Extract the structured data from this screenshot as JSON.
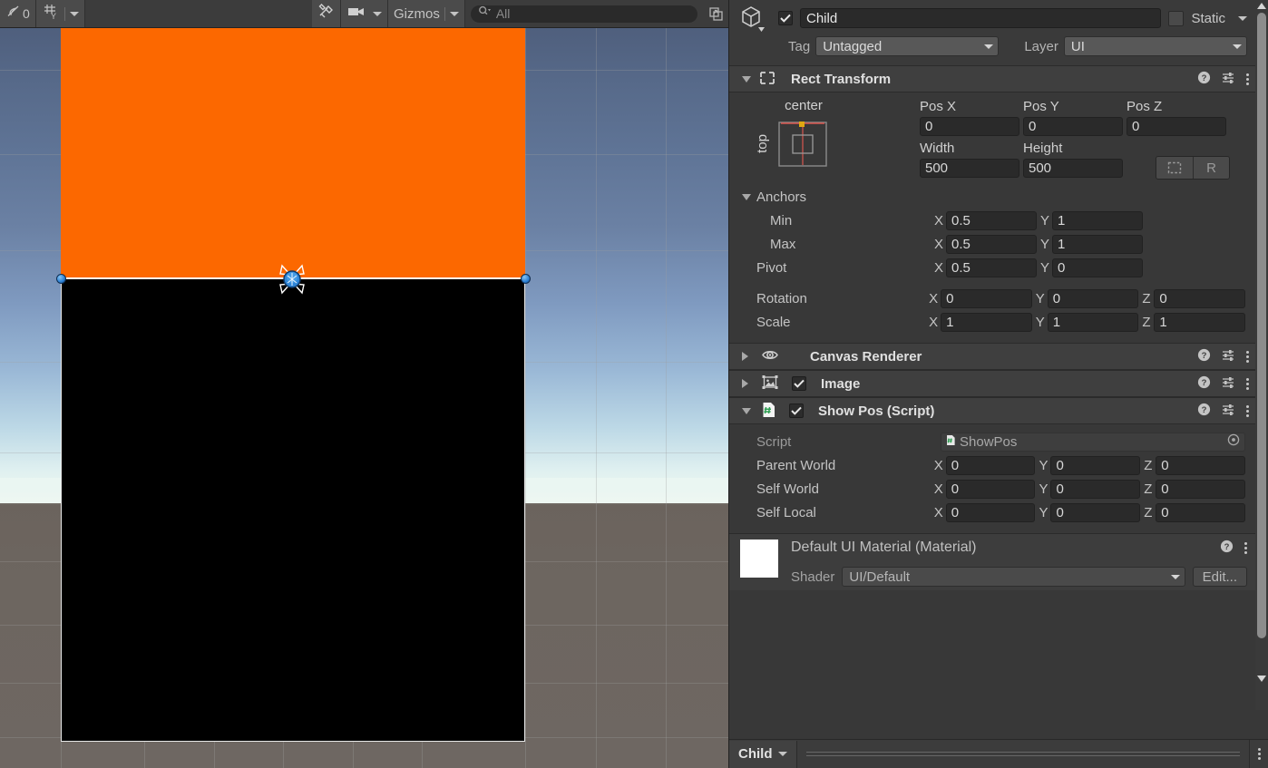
{
  "scene": {
    "toolbar": {
      "draw_mode_count": "0",
      "grid_axis": "Y",
      "gizmos_label": "Gizmos",
      "search_placeholder": "All",
      "search_value": "",
      "icons": {
        "lighting": "lighting-off-icon",
        "grid": "grid-axis-icon",
        "tools": "tools-icon",
        "camera": "scene-camera-icon",
        "search": "search-icon",
        "maximize": "open-in-new-icon"
      }
    },
    "selected_rect": {
      "fill_color": "#fc6800",
      "child_color": "#000000",
      "outline_color": "#ffffff"
    }
  },
  "inspector": {
    "object": {
      "enabled": true,
      "name_value": "Child",
      "name_placeholder": "Name",
      "static_label": "Static",
      "static_checked": false,
      "tag_label": "Tag",
      "tag_value": "Untagged",
      "layer_label": "Layer",
      "layer_value": "UI"
    },
    "rect_transform": {
      "title": "Rect Transform",
      "expanded": true,
      "anchor_preset": {
        "horizontal": "center",
        "vertical": "top"
      },
      "columns": [
        "Pos X",
        "Pos Y",
        "Pos Z"
      ],
      "pos": {
        "x": "0",
        "y": "0",
        "z": "0"
      },
      "size_columns": [
        "Width",
        "Height"
      ],
      "size": {
        "width": "500",
        "height": "500"
      },
      "blueprint_button": "blueprint-mode-icon",
      "raw_button": "R",
      "anchors_label": "Anchors",
      "anchors": {
        "min_label": "Min",
        "min_x": "0.5",
        "min_y": "1",
        "max_label": "Max",
        "max_x": "0.5",
        "max_y": "1"
      },
      "pivot": {
        "label": "Pivot",
        "x": "0.5",
        "y": "0"
      },
      "rotation": {
        "label": "Rotation",
        "x": "0",
        "y": "0",
        "z": "0"
      },
      "scale": {
        "label": "Scale",
        "x": "1",
        "y": "1",
        "z": "1"
      },
      "axis": {
        "x": "X",
        "y": "Y",
        "z": "Z"
      }
    },
    "components": [
      {
        "title": "Canvas Renderer",
        "expanded": false,
        "has_enable_toggle": false,
        "icon": "eye-icon"
      },
      {
        "title": "Image",
        "expanded": false,
        "has_enable_toggle": true,
        "enabled": true,
        "icon": "image-component-icon"
      },
      {
        "title": "Show Pos (Script)",
        "expanded": true,
        "has_enable_toggle": true,
        "enabled": true,
        "icon": "cs-script-icon"
      }
    ],
    "show_pos": {
      "script_label": "Script",
      "script_value": "ShowPos",
      "script_icon": "cs-script-icon",
      "object_picker": "object-picker-icon",
      "rows": [
        {
          "label": "Parent World",
          "x": "0",
          "y": "0",
          "z": "0"
        },
        {
          "label": "Self World",
          "x": "0",
          "y": "0",
          "z": "0"
        },
        {
          "label": "Self Local",
          "x": "0",
          "y": "0",
          "z": "0"
        }
      ]
    },
    "material": {
      "title": "Default UI Material (Material)",
      "shader_label": "Shader",
      "shader_value": "UI/Default",
      "edit_label": "Edit..."
    },
    "footer": {
      "label": "Child"
    },
    "header_icons": {
      "help": "help-icon",
      "preset": "preset-icon",
      "menu": "kebab-menu-icon"
    }
  }
}
